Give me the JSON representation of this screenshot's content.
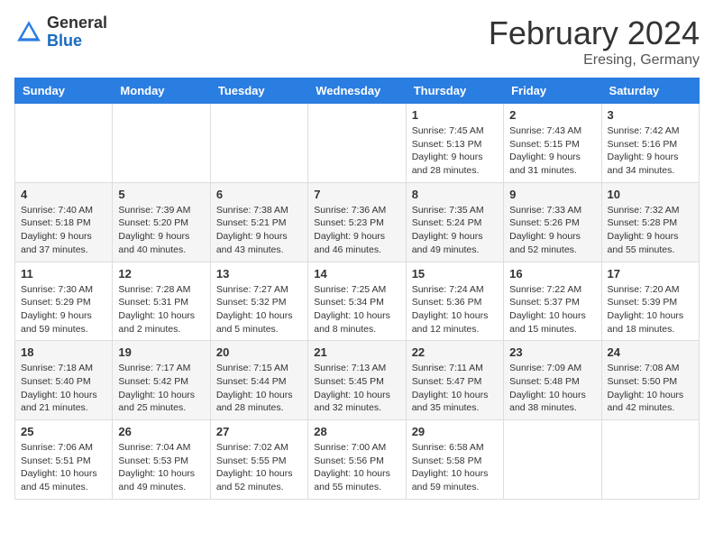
{
  "header": {
    "logo_general": "General",
    "logo_blue": "Blue",
    "month_title": "February 2024",
    "location": "Eresing, Germany"
  },
  "weekdays": [
    "Sunday",
    "Monday",
    "Tuesday",
    "Wednesday",
    "Thursday",
    "Friday",
    "Saturday"
  ],
  "weeks": [
    [
      {
        "day": "",
        "info": ""
      },
      {
        "day": "",
        "info": ""
      },
      {
        "day": "",
        "info": ""
      },
      {
        "day": "",
        "info": ""
      },
      {
        "day": "1",
        "info": "Sunrise: 7:45 AM\nSunset: 5:13 PM\nDaylight: 9 hours\nand 28 minutes."
      },
      {
        "day": "2",
        "info": "Sunrise: 7:43 AM\nSunset: 5:15 PM\nDaylight: 9 hours\nand 31 minutes."
      },
      {
        "day": "3",
        "info": "Sunrise: 7:42 AM\nSunset: 5:16 PM\nDaylight: 9 hours\nand 34 minutes."
      }
    ],
    [
      {
        "day": "4",
        "info": "Sunrise: 7:40 AM\nSunset: 5:18 PM\nDaylight: 9 hours\nand 37 minutes."
      },
      {
        "day": "5",
        "info": "Sunrise: 7:39 AM\nSunset: 5:20 PM\nDaylight: 9 hours\nand 40 minutes."
      },
      {
        "day": "6",
        "info": "Sunrise: 7:38 AM\nSunset: 5:21 PM\nDaylight: 9 hours\nand 43 minutes."
      },
      {
        "day": "7",
        "info": "Sunrise: 7:36 AM\nSunset: 5:23 PM\nDaylight: 9 hours\nand 46 minutes."
      },
      {
        "day": "8",
        "info": "Sunrise: 7:35 AM\nSunset: 5:24 PM\nDaylight: 9 hours\nand 49 minutes."
      },
      {
        "day": "9",
        "info": "Sunrise: 7:33 AM\nSunset: 5:26 PM\nDaylight: 9 hours\nand 52 minutes."
      },
      {
        "day": "10",
        "info": "Sunrise: 7:32 AM\nSunset: 5:28 PM\nDaylight: 9 hours\nand 55 minutes."
      }
    ],
    [
      {
        "day": "11",
        "info": "Sunrise: 7:30 AM\nSunset: 5:29 PM\nDaylight: 9 hours\nand 59 minutes."
      },
      {
        "day": "12",
        "info": "Sunrise: 7:28 AM\nSunset: 5:31 PM\nDaylight: 10 hours\nand 2 minutes."
      },
      {
        "day": "13",
        "info": "Sunrise: 7:27 AM\nSunset: 5:32 PM\nDaylight: 10 hours\nand 5 minutes."
      },
      {
        "day": "14",
        "info": "Sunrise: 7:25 AM\nSunset: 5:34 PM\nDaylight: 10 hours\nand 8 minutes."
      },
      {
        "day": "15",
        "info": "Sunrise: 7:24 AM\nSunset: 5:36 PM\nDaylight: 10 hours\nand 12 minutes."
      },
      {
        "day": "16",
        "info": "Sunrise: 7:22 AM\nSunset: 5:37 PM\nDaylight: 10 hours\nand 15 minutes."
      },
      {
        "day": "17",
        "info": "Sunrise: 7:20 AM\nSunset: 5:39 PM\nDaylight: 10 hours\nand 18 minutes."
      }
    ],
    [
      {
        "day": "18",
        "info": "Sunrise: 7:18 AM\nSunset: 5:40 PM\nDaylight: 10 hours\nand 21 minutes."
      },
      {
        "day": "19",
        "info": "Sunrise: 7:17 AM\nSunset: 5:42 PM\nDaylight: 10 hours\nand 25 minutes."
      },
      {
        "day": "20",
        "info": "Sunrise: 7:15 AM\nSunset: 5:44 PM\nDaylight: 10 hours\nand 28 minutes."
      },
      {
        "day": "21",
        "info": "Sunrise: 7:13 AM\nSunset: 5:45 PM\nDaylight: 10 hours\nand 32 minutes."
      },
      {
        "day": "22",
        "info": "Sunrise: 7:11 AM\nSunset: 5:47 PM\nDaylight: 10 hours\nand 35 minutes."
      },
      {
        "day": "23",
        "info": "Sunrise: 7:09 AM\nSunset: 5:48 PM\nDaylight: 10 hours\nand 38 minutes."
      },
      {
        "day": "24",
        "info": "Sunrise: 7:08 AM\nSunset: 5:50 PM\nDaylight: 10 hours\nand 42 minutes."
      }
    ],
    [
      {
        "day": "25",
        "info": "Sunrise: 7:06 AM\nSunset: 5:51 PM\nDaylight: 10 hours\nand 45 minutes."
      },
      {
        "day": "26",
        "info": "Sunrise: 7:04 AM\nSunset: 5:53 PM\nDaylight: 10 hours\nand 49 minutes."
      },
      {
        "day": "27",
        "info": "Sunrise: 7:02 AM\nSunset: 5:55 PM\nDaylight: 10 hours\nand 52 minutes."
      },
      {
        "day": "28",
        "info": "Sunrise: 7:00 AM\nSunset: 5:56 PM\nDaylight: 10 hours\nand 55 minutes."
      },
      {
        "day": "29",
        "info": "Sunrise: 6:58 AM\nSunset: 5:58 PM\nDaylight: 10 hours\nand 59 minutes."
      },
      {
        "day": "",
        "info": ""
      },
      {
        "day": "",
        "info": ""
      }
    ]
  ]
}
